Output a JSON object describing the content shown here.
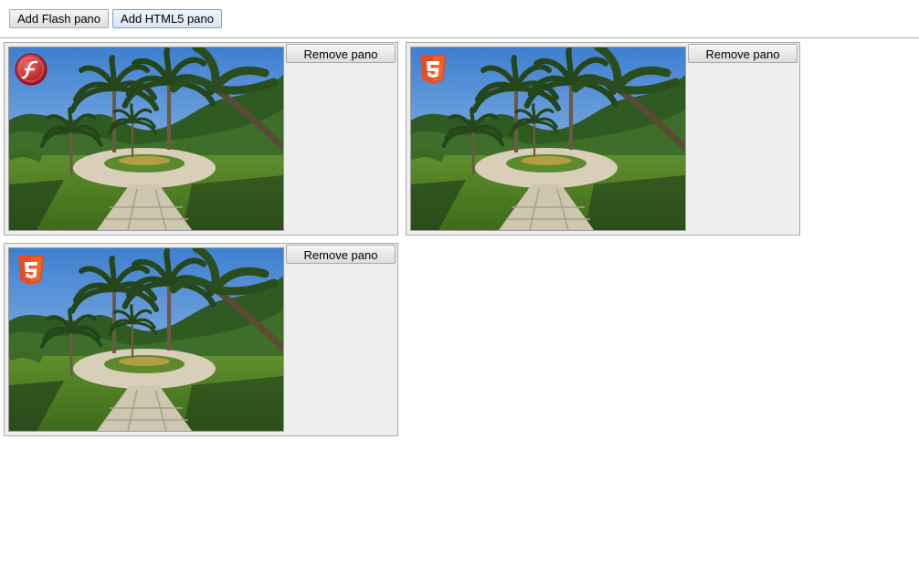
{
  "toolbar": {
    "add_flash_label": "Add Flash pano",
    "add_html5_label": "Add HTML5 pano"
  },
  "panos": [
    {
      "kind": "flash",
      "badge_icon": "flash-player-icon",
      "remove_label": "Remove pano"
    },
    {
      "kind": "html5",
      "badge_icon": "html5-icon",
      "remove_label": "Remove pano"
    },
    {
      "kind": "html5",
      "badge_icon": "html5-icon",
      "remove_label": "Remove pano"
    }
  ],
  "colors": {
    "flash_red": "#c8141e",
    "html5_orange": "#e44d26",
    "card_bg": "#eeeeee"
  }
}
